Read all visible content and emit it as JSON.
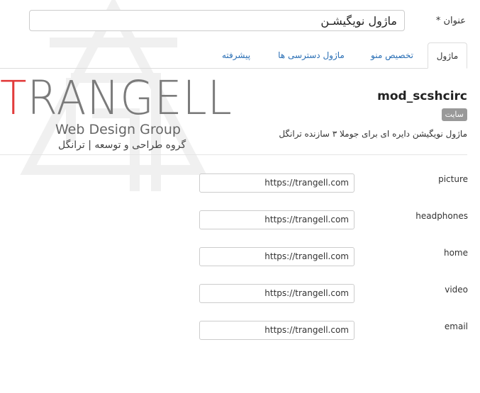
{
  "title_field": {
    "label": "عنوان *",
    "value": "ماژول نویگیشـن"
  },
  "tabs": [
    {
      "label": "ماژول",
      "active": true
    },
    {
      "label": "تخصیص منو",
      "active": false
    },
    {
      "label": "ماژول دسترسی ها",
      "active": false
    },
    {
      "label": "پیشرفته",
      "active": false
    }
  ],
  "logo": {
    "first_letter": "T",
    "rest": "RANGELL",
    "subtitle": "Web Design Group",
    "subtitle_fa": "گروه طراحی و توسعه | ترانگل",
    "accent_color": "#e23b3b",
    "text_color": "#7b7b7b"
  },
  "module": {
    "name": "mod_scshcirc",
    "badge": "سایت",
    "description": "ماژول نویگیشن دایره ای برای جوملا ۳ سازنده ترانگل"
  },
  "fields": [
    {
      "label": "picture",
      "value": "https://trangell.com"
    },
    {
      "label": "headphones",
      "value": "https://trangell.com"
    },
    {
      "label": "home",
      "value": "https://trangell.com"
    },
    {
      "label": "video",
      "value": "https://trangell.com"
    },
    {
      "label": "email",
      "value": "https://trangell.com"
    }
  ],
  "colors": {
    "link": "#2a6fb5",
    "badge_bg": "#999999",
    "border": "#cccccc"
  }
}
